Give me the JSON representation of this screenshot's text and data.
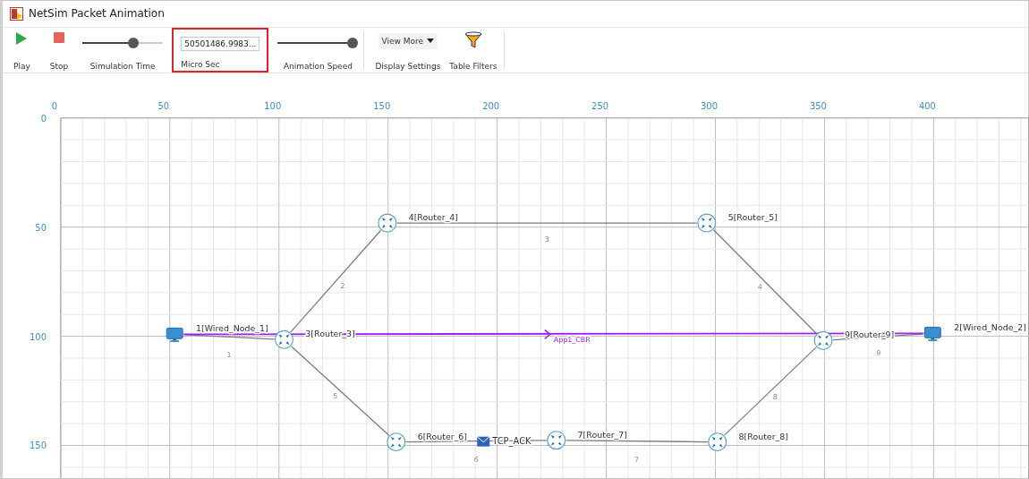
{
  "window": {
    "title": "NetSim Packet Animation"
  },
  "toolbar": [
    {
      "kind": "play",
      "label": "Play"
    },
    {
      "kind": "stop",
      "label": "Stop"
    },
    {
      "kind": "slider",
      "label": "Simulation Time",
      "level": 0.65
    },
    {
      "kind": "field",
      "value": "50501486.9983...",
      "label": "Micro Sec",
      "highlighted": true
    },
    {
      "kind": "slider",
      "label": "Animation Speed",
      "level": 1.0
    },
    {
      "kind": "dropdown",
      "value": "View More",
      "label": "Display Settings"
    },
    {
      "kind": "filter",
      "label": "Table Filters"
    }
  ],
  "canvas": {
    "x_ruler": [
      "0",
      "50",
      "100",
      "150",
      "200",
      "250",
      "300",
      "350",
      "400"
    ],
    "y_ruler": [
      "0",
      "50",
      "100",
      "150"
    ],
    "nodes": [
      {
        "kind": "computer",
        "label": "1[Wired_Node_1]"
      },
      {
        "kind": "router",
        "label": "3[Router_3]"
      },
      {
        "kind": "router",
        "label": "4[Router_4]"
      },
      {
        "kind": "router",
        "label": "5[Router_5]"
      },
      {
        "kind": "router",
        "label": "9[Router_9]"
      },
      {
        "kind": "computer",
        "label": "2[Wired_Node_2]"
      },
      {
        "kind": "router",
        "label": "6[Router_6]"
      },
      {
        "kind": "router",
        "label": "7[Router_7]"
      },
      {
        "kind": "router",
        "label": "8[Router_8]"
      }
    ],
    "links": [
      {
        "label": "1"
      },
      {
        "label": "2"
      },
      {
        "label": "3"
      },
      {
        "label": "4"
      },
      {
        "label": "5"
      },
      {
        "label": "6"
      },
      {
        "label": "7"
      },
      {
        "label": "8"
      },
      {
        "label": "9"
      }
    ],
    "flow": {
      "label": "App1_CBR"
    },
    "packet": {
      "label": "TCP_ACK"
    }
  }
}
